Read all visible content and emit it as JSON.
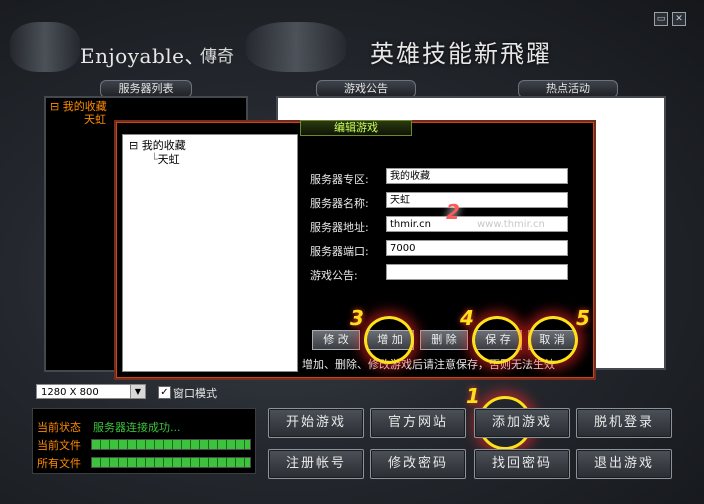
{
  "window": {
    "minimize_glyph": "▭",
    "close_glyph": "✕"
  },
  "header": {
    "brand": "Enjoyable、",
    "brand_sub": "傳奇",
    "slogan": "英雄技能新飛躍"
  },
  "panels": {
    "server_list_title": "服务器列表",
    "notice_title": "游戏公告",
    "events_title": "热点活动"
  },
  "server_tree": {
    "root_label": "我的收藏",
    "child_label": "天虹"
  },
  "dialog": {
    "title": "编辑游戏",
    "tree_root": "我的收藏",
    "tree_child": "天虹",
    "fields": {
      "zone_label": "服务器专区:",
      "zone_value": "我的收藏",
      "name_label": "服务器名称:",
      "name_value": "天虹",
      "address_label": "服务器地址:",
      "address_value": "thmir.cn",
      "port_label": "服务器端口:",
      "port_value": "7000",
      "notice_label": "游戏公告:",
      "notice_value": ""
    },
    "buttons": {
      "modify": "修 改",
      "add": "增 加",
      "delete": "删 除",
      "save": "保 存",
      "cancel": "取 消"
    },
    "hint": "增加、删除、修改游戏后请注意保存，否则无法生效"
  },
  "annotations": {
    "n1": "1",
    "n2": "2",
    "n3": "3",
    "n4": "4",
    "n5": "5"
  },
  "watermark": "www.thmir.cn",
  "display": {
    "resolution": "1280 X 800",
    "window_mode_label": "窗口模式",
    "window_mode_checked": true
  },
  "status": {
    "state_label": "当前状态",
    "state_value": "服务器连接成功...",
    "current_file_label": "当前文件",
    "all_files_label": "所有文件",
    "current_progress": 1.0,
    "all_progress": 1.0
  },
  "buttons": {
    "start_game": "开始游戏",
    "official_site": "官方网站",
    "add_game": "添加游戏",
    "offline_login": "脱机登录",
    "register": "注册帐号",
    "change_password": "修改密码",
    "recover_password": "找回密码",
    "exit_game": "退出游戏"
  },
  "colors": {
    "accent_orange": "#ff8a00",
    "status_green": "#3cc23c",
    "ring_yellow": "#ffe11a"
  }
}
